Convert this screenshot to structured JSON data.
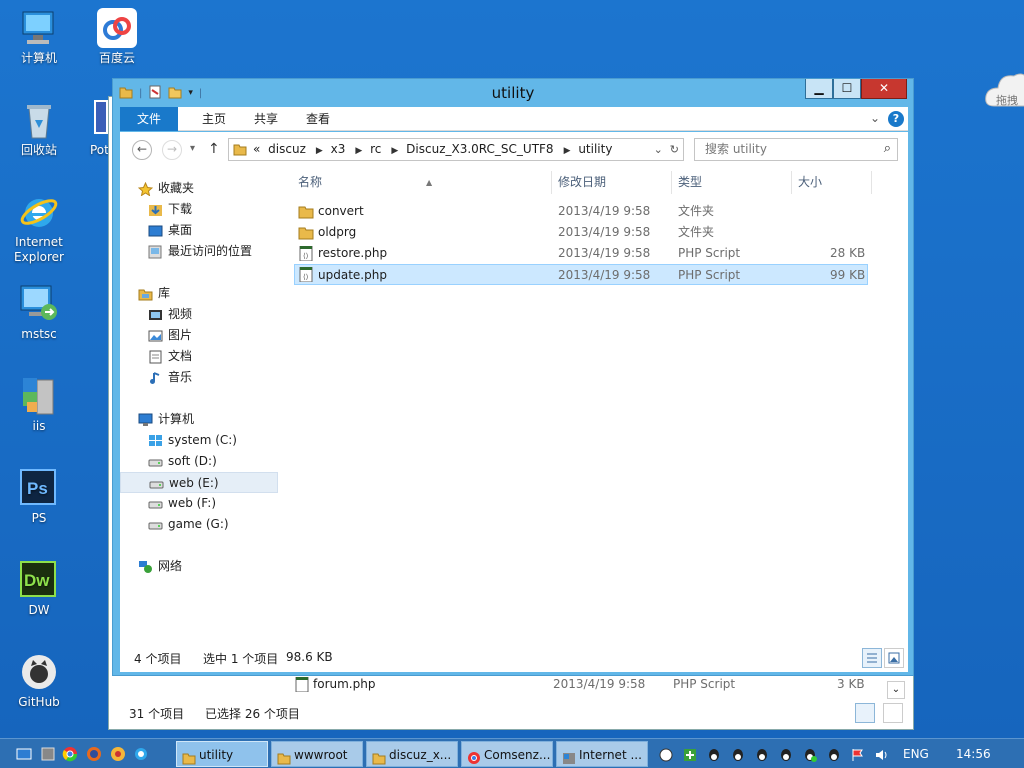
{
  "desktop": {
    "icons": [
      {
        "label": "计算机",
        "icon": "computer-icon"
      },
      {
        "label": "百度云",
        "icon": "baidu-cloud-icon"
      },
      {
        "label": "回收站",
        "icon": "recycle-bin-icon"
      },
      {
        "label": "Pot",
        "icon": "potplayer-icon"
      },
      {
        "label": "Internet Explorer",
        "icon": "ie-icon"
      },
      {
        "label": "mstsc",
        "icon": "remote-desktop-icon"
      },
      {
        "label": "iis",
        "icon": "iis-icon"
      },
      {
        "label": "PS",
        "icon": "photoshop-icon"
      },
      {
        "label": "DW",
        "icon": "dreamweaver-icon"
      },
      {
        "label": "GitHub",
        "icon": "github-icon"
      }
    ],
    "cloud_widget_label": "拖拽"
  },
  "background_window": {
    "row": {
      "name": "forum.php",
      "date": "2013/4/19 9:58",
      "type": "PHP Script",
      "size": "3 KB"
    },
    "status_count": "31 个项目",
    "status_selected": "已选择 26 个项目"
  },
  "window": {
    "title": "utility",
    "controls": {
      "minimize": "▁",
      "maximize": "☐",
      "close": "✕"
    },
    "ribbon_tabs": [
      "文件",
      "主页",
      "共享",
      "查看"
    ],
    "address": {
      "overflow": "«",
      "crumbs": [
        "discuz",
        "x3",
        "rc",
        "Discuz_X3.0RC_SC_UTF8",
        "utility"
      ]
    },
    "search_placeholder": "搜索 utility",
    "nav": {
      "favorites": {
        "label": "收藏夹",
        "items": [
          "下载",
          "桌面",
          "最近访问的位置"
        ]
      },
      "libraries": {
        "label": "库",
        "items": [
          "视频",
          "图片",
          "文档",
          "音乐"
        ]
      },
      "computer": {
        "label": "计算机",
        "items": [
          "system (C:)",
          "soft (D:)",
          "web (E:)",
          "web (F:)",
          "game (G:)"
        ]
      },
      "network": {
        "label": "网络"
      }
    },
    "columns": {
      "name": "名称",
      "date": "修改日期",
      "type": "类型",
      "size": "大小"
    },
    "files": [
      {
        "name": "convert",
        "date": "2013/4/19 9:58",
        "type": "文件夹",
        "size": "",
        "kind": "folder"
      },
      {
        "name": "oldprg",
        "date": "2013/4/19 9:58",
        "type": "文件夹",
        "size": "",
        "kind": "folder"
      },
      {
        "name": "restore.php",
        "date": "2013/4/19 9:58",
        "type": "PHP Script",
        "size": "28 KB",
        "kind": "php"
      },
      {
        "name": "update.php",
        "date": "2013/4/19 9:58",
        "type": "PHP Script",
        "size": "99 KB",
        "kind": "php"
      }
    ],
    "status": {
      "count": "4 个项目",
      "selected": "选中 1 个项目",
      "size": "98.6 KB"
    }
  },
  "taskbar": {
    "buttons": [
      "utility",
      "wwwroot",
      "discuz_x...",
      "Comsenz...",
      "Internet ..."
    ],
    "lang": "ENG",
    "time": "14:56"
  }
}
